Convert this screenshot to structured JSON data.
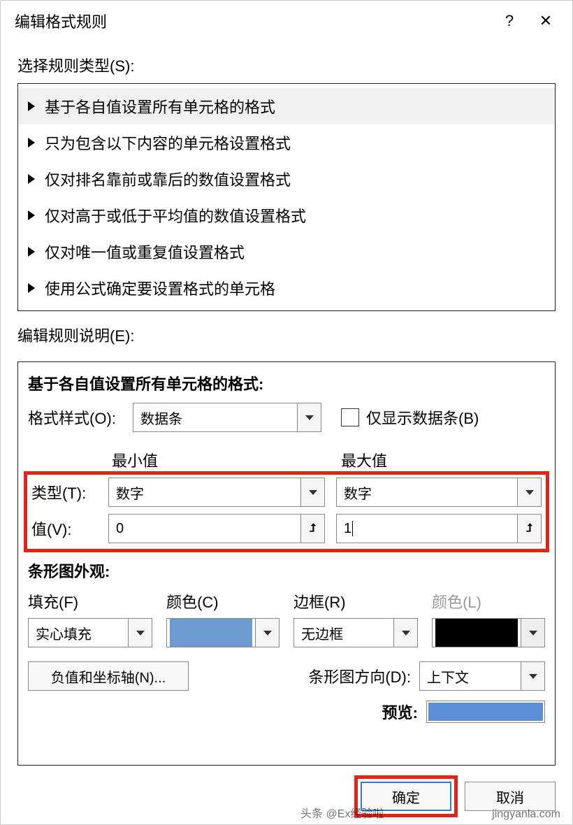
{
  "titlebar": {
    "title": "编辑格式规则",
    "help": "?",
    "close": "✕"
  },
  "select_rule_label": "选择规则类型(S):",
  "rules": {
    "r0": "基于各自值设置所有单元格的格式",
    "r1": "只为包含以下内容的单元格设置格式",
    "r2": "仅对排名靠前或靠后的数值设置格式",
    "r3": "仅对高于或低于平均值的数值设置格式",
    "r4": "仅对唯一值或重复值设置格式",
    "r5": "使用公式确定要设置格式的单元格"
  },
  "edit_desc_label": "编辑规则说明(E):",
  "desc": {
    "heading": "基于各自值设置所有单元格的格式:",
    "style_label": "格式样式(O):",
    "style_value": "数据条",
    "show_bar_only": "仅显示数据条(B)",
    "min_title": "最小值",
    "max_title": "最大值",
    "type_label": "类型(T):",
    "type_min": "数字",
    "type_max": "数字",
    "value_label": "值(V):",
    "value_min": "0",
    "value_max": "1"
  },
  "appearance": {
    "heading": "条形图外观:",
    "fill_label": "填充(F)",
    "color_label": "颜色(C)",
    "border_label": "边框(R)",
    "border_color_label": "颜色(L)",
    "fill_value": "实心填充",
    "border_value": "无边框",
    "neg_axis_btn": "负值和坐标轴(N)...",
    "direction_label": "条形图方向(D):",
    "direction_value": "上下文",
    "preview_label": "预览:",
    "fill_color": "#6b9bd1",
    "border_color": "#000000"
  },
  "buttons": {
    "ok": "确定",
    "cancel": "取消"
  },
  "watermark1": "头条 @Ex经验啦",
  "watermark2": "jingyanla.com"
}
